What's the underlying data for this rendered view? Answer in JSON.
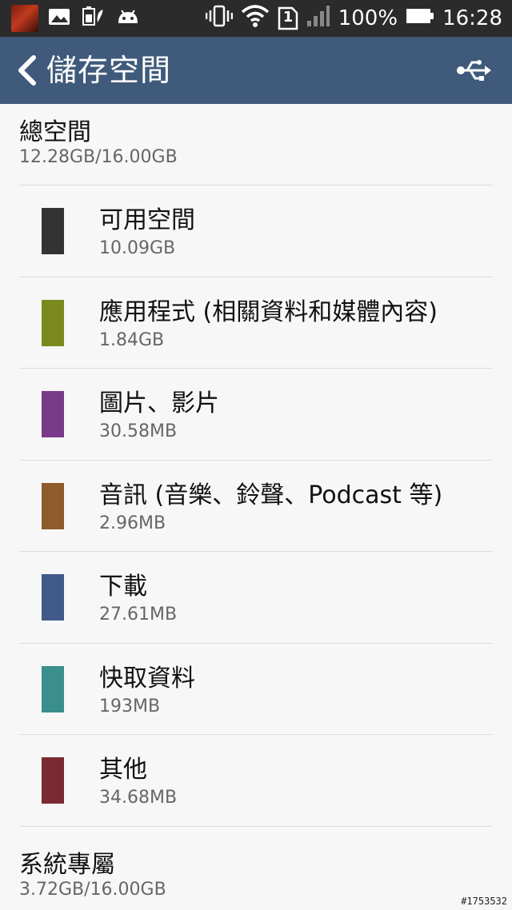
{
  "status_bar": {
    "battery": "100%",
    "time": "16:28",
    "sim": "1",
    "icons": [
      "game-avatar-icon",
      "image-icon",
      "battery-saver-icon",
      "android-icon",
      "vibrate-icon",
      "wifi-icon",
      "sim-icon",
      "signal-icon",
      "battery-icon"
    ]
  },
  "app_bar": {
    "title": "儲存空間",
    "back_icon": "back-arrow-icon",
    "usb_icon": "usb-icon"
  },
  "total": {
    "title": "總空間",
    "value": "12.28GB/16.00GB"
  },
  "items": [
    {
      "label": "可用空間",
      "size": "10.09GB",
      "color": "#333333"
    },
    {
      "label": "應用程式 (相關資料和媒體內容)",
      "size": "1.84GB",
      "color": "#7a8a1e"
    },
    {
      "label": "圖片、影片",
      "size": "30.58MB",
      "color": "#7a3a8a"
    },
    {
      "label": "音訊 (音樂、鈴聲、Podcast 等)",
      "size": "2.96MB",
      "color": "#8f5a2c"
    },
    {
      "label": "下載",
      "size": "27.61MB",
      "color": "#415a8a"
    },
    {
      "label": "快取資料",
      "size": "193MB",
      "color": "#3a8f8c"
    },
    {
      "label": "其他",
      "size": "34.68MB",
      "color": "#7a2a32"
    }
  ],
  "system": {
    "title": "系統專屬",
    "value": "3.72GB/16.00GB"
  },
  "watermark": "#1753532"
}
